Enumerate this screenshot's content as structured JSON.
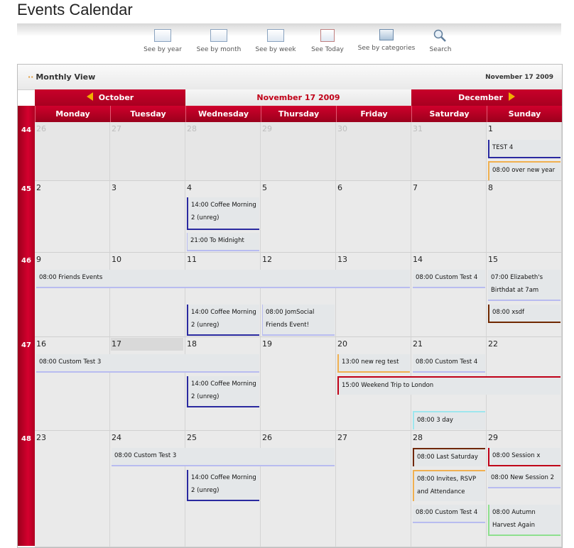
{
  "page": {
    "title": "Events Calendar"
  },
  "toolbar": {
    "items": [
      {
        "label": "See by year",
        "icon": "calendar-year-icon"
      },
      {
        "label": "See by month",
        "icon": "calendar-month-icon"
      },
      {
        "label": "See by week",
        "icon": "calendar-week-icon"
      },
      {
        "label": "See Today",
        "icon": "calendar-today-icon"
      },
      {
        "label": "See by categories",
        "icon": "folder-icon"
      },
      {
        "label": "Search",
        "icon": "magnifier-icon"
      }
    ]
  },
  "calendar": {
    "view_title": "Monthly View",
    "view_date": "November 17 2009",
    "prev_month": "October",
    "current": "November 17 2009",
    "next_month": "December",
    "days": [
      "Monday",
      "Tuesday",
      "Wednesday",
      "Thursday",
      "Friday",
      "Saturday",
      "Sunday"
    ],
    "weeks": [
      {
        "week": "44",
        "dates": [
          "26",
          "27",
          "28",
          "29",
          "30",
          "31",
          "1"
        ]
      },
      {
        "week": "45",
        "dates": [
          "2",
          "3",
          "4",
          "5",
          "6",
          "7",
          "8"
        ]
      },
      {
        "week": "46",
        "dates": [
          "9",
          "10",
          "11",
          "12",
          "13",
          "14",
          "15"
        ]
      },
      {
        "week": "47",
        "dates": [
          "16",
          "17",
          "18",
          "19",
          "20",
          "21",
          "22"
        ]
      },
      {
        "week": "48",
        "dates": [
          "23",
          "24",
          "25",
          "26",
          "27",
          "28",
          "29"
        ]
      }
    ],
    "events": [
      {
        "text": "TEST 4"
      },
      {
        "text": "08:00 over new year"
      },
      {
        "text": "14:00 Coffee Morning 2 (unreg)"
      },
      {
        "text": "21:00 To Midnight"
      },
      {
        "text": "08:00 Friends Events"
      },
      {
        "text": "08:00 Custom Test 4"
      },
      {
        "text": "07:00 Elizabeth's Birthdat at 7am"
      },
      {
        "text": "14:00 Coffee Morning 2 (unreg)"
      },
      {
        "text": "08:00 JomSocial Friends Event!"
      },
      {
        "text": "08:00 xsdf"
      },
      {
        "text": "08:00 Custom Test 3"
      },
      {
        "text": "13:00 new reg test"
      },
      {
        "text": "08:00 Custom Test 4"
      },
      {
        "text": "14:00 Coffee Morning 2 (unreg)"
      },
      {
        "text": "15:00 Weekend Trip to London"
      },
      {
        "text": "08:00 3 day"
      },
      {
        "text": "08:00 Custom Test 3"
      },
      {
        "text": "08:00 Last Saturday"
      },
      {
        "text": "08:00 Session x"
      },
      {
        "text": "14:00 Coffee Morning 2 (unreg)"
      },
      {
        "text": "08:00 Invites, RSVP and Attendance"
      },
      {
        "text": "08:00 New Session 2"
      },
      {
        "text": "08:00 Custom Test 4"
      },
      {
        "text": "08:00 Autumn Harvest Again"
      }
    ]
  }
}
